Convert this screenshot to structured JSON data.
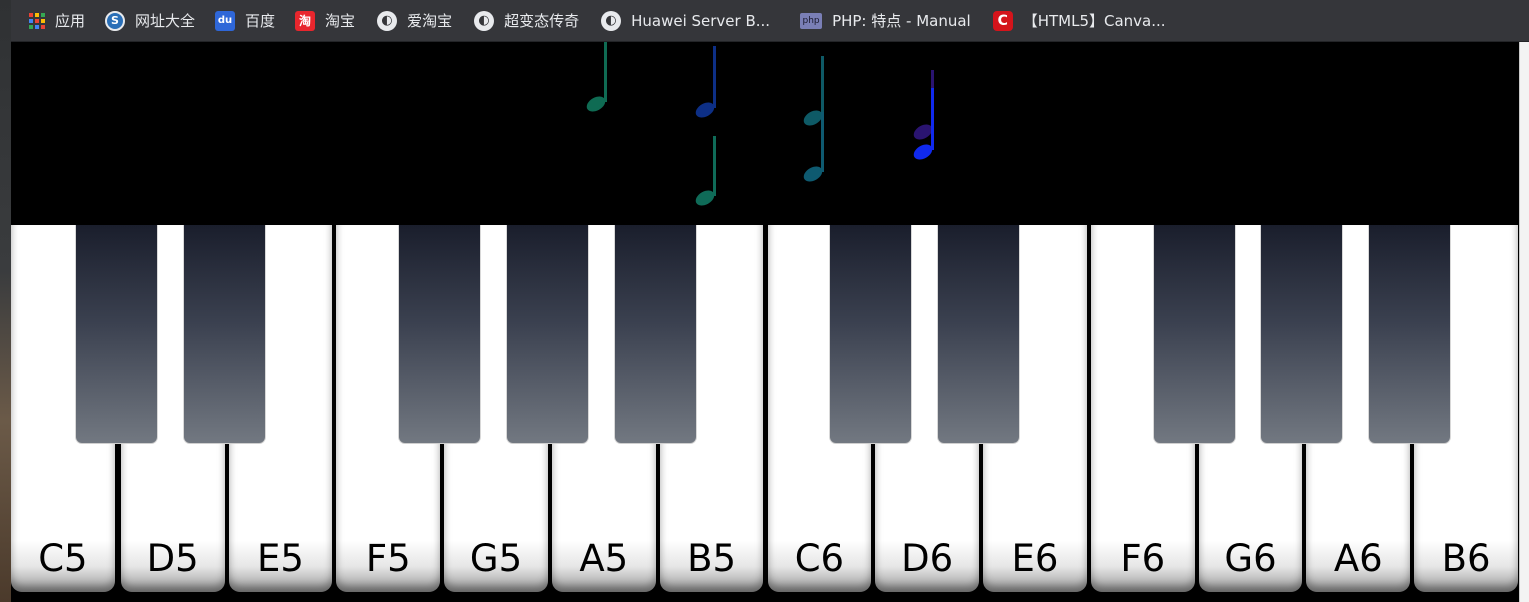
{
  "bookmarks": [
    {
      "label": "应用",
      "icon": "apps-grid-icon",
      "icon_text": ""
    },
    {
      "label": "网址大全",
      "icon": "sogou-icon",
      "icon_text": "S"
    },
    {
      "label": "百度",
      "icon": "baidu-icon",
      "icon_text": "du"
    },
    {
      "label": "淘宝",
      "icon": "taobao-icon",
      "icon_text": "淘"
    },
    {
      "label": "爱淘宝",
      "icon": "globe-icon",
      "icon_text": "◐"
    },
    {
      "label": "超变态传奇",
      "icon": "globe-icon",
      "icon_text": "◐"
    },
    {
      "label": "Huawei Server B...",
      "icon": "globe-icon",
      "icon_text": "◐"
    },
    {
      "label": "PHP: 特点 - Manual",
      "icon": "php-icon",
      "icon_text": "php"
    },
    {
      "label": "【HTML5】Canva...",
      "icon": "csdn-icon",
      "icon_text": "C"
    }
  ],
  "piano": {
    "white_keys": [
      "C5",
      "D5",
      "E5",
      "F5",
      "G5",
      "A5",
      "B5",
      "C6",
      "D6",
      "E6",
      "F6",
      "G6",
      "A6",
      "B6"
    ],
    "black_keys_after": [
      "C5",
      "D5",
      "F5",
      "G5",
      "A5",
      "C6",
      "D6",
      "F6",
      "G6",
      "A6"
    ]
  },
  "notes": [
    {
      "color": "#0f6b53"
    },
    {
      "color": "#0d2f86"
    },
    {
      "color": "#0e5a66"
    },
    {
      "color": "#0f6b58"
    },
    {
      "color": "#0e5a70"
    },
    {
      "color": "#2a1470"
    },
    {
      "color": "#1029ee"
    }
  ],
  "colors": {
    "stage_background": "#000000",
    "toolbar_background": "#35363a"
  }
}
